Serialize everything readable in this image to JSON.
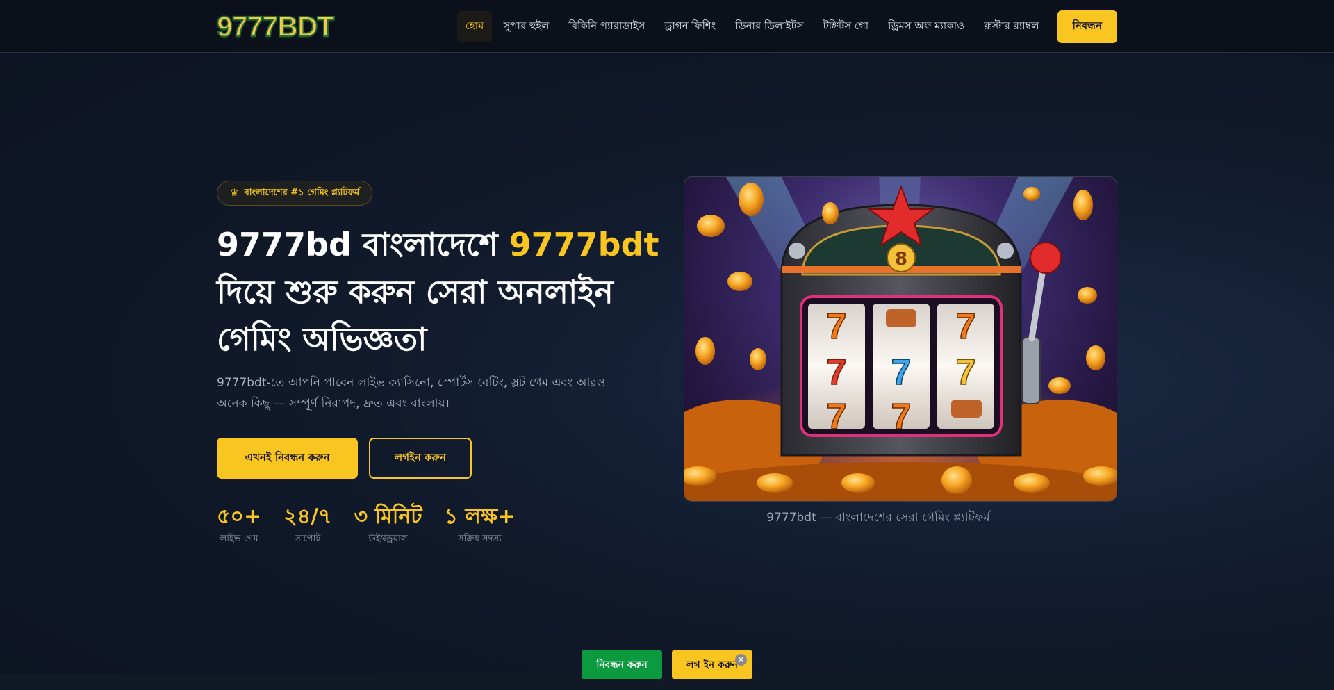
{
  "header": {
    "logo": "9777BDT",
    "nav": [
      {
        "label": "হোম",
        "active": true
      },
      {
        "label": "সুপার হুইল"
      },
      {
        "label": "বিকিনি প্যারাডাইস"
      },
      {
        "label": "ড্রাগন ফিশিং"
      },
      {
        "label": "ডিনার ডিলাইটস"
      },
      {
        "label": "টঙ্গিটস গো"
      },
      {
        "label": "ড্রিমস অফ ম্যাকাও"
      },
      {
        "label": "রুস্টার র‍্যাম্বল"
      }
    ],
    "register_label": "নিবন্ধন"
  },
  "hero": {
    "badge": "বাংলাদেশের #১ গেমিং প্ল্যাটফর্ম",
    "badge_icon": "crown-icon",
    "title_part1": "9777bd বাংলাদেশে ",
    "title_accent": "9777bdt",
    "title_part2": "দিয়ে শুরু করুন সেরা অনলাইন গেমিং অভিজ্ঞতা",
    "description": "9777bdt-তে আপনি পাবেন লাইভ ক্যাসিনো, স্পোর্টস বেটিং, স্লট গেম এবং আরও অনেক কিছু — সম্পূর্ণ নিরাপদ, দ্রুত এবং বাংলায়।",
    "primary_button": "এখনই নিবন্ধন করুন",
    "secondary_button": "লগইন করুন",
    "stats": [
      {
        "value": "৫০+",
        "label": "লাইভ গেম"
      },
      {
        "value": "২৪/৭",
        "label": "সাপোর্ট"
      },
      {
        "value": "৩ মিনিট",
        "label": "উইথড্রয়াল"
      },
      {
        "value": "১ লক্ষ+",
        "label": "সক্রিয় সদস্য"
      }
    ],
    "image_caption": "9777bdt — বাংলাদেশের সেরা গেমিং প্ল্যাটফর্ম",
    "machine_number": "8"
  },
  "floating_bar": {
    "register": "নিবন্ধন করুন",
    "login": "লগ ইন করুন",
    "close": "✕"
  },
  "colors": {
    "accent": "#f9c521",
    "green": "#0b9a3e",
    "background": "#111a2b"
  }
}
